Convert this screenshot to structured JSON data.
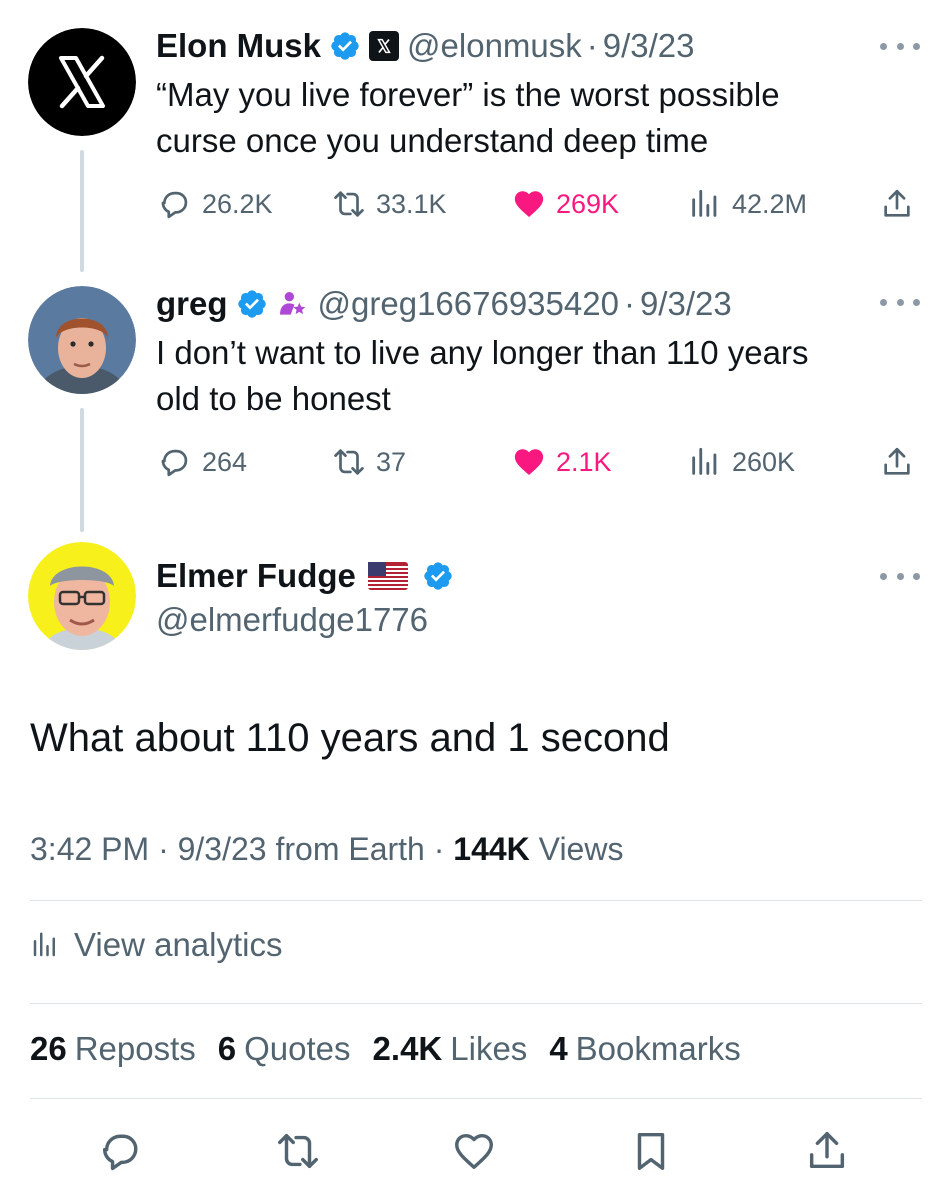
{
  "thread": [
    {
      "name": "Elon Musk",
      "handle": "@elonmusk",
      "separator": "·",
      "date": "9/3/23",
      "text_line1": "“May you live forever” is the worst possible",
      "text_line2": "curse once you understand deep time",
      "replies": "26.2K",
      "reposts": "33.1K",
      "likes": "269K",
      "views": "42.2M"
    },
    {
      "name": "greg",
      "handle": "@greg16676935420",
      "separator": "·",
      "date": "9/3/23",
      "text_line1": "I don’t want to live any longer than 110 years",
      "text_line2": "old to be honest",
      "replies": "264",
      "reposts": "37",
      "likes": "2.1K",
      "views": "260K"
    }
  ],
  "main_tweet": {
    "name": "Elmer Fudge",
    "handle": "@elmerfudge1776",
    "text": "What about 110 years and 1 second",
    "time": "3:42 PM",
    "separator": "·",
    "date_source": "9/3/23 from Earth",
    "views_count": "144K",
    "views_label": "Views",
    "analytics_label": "View analytics",
    "stats": [
      {
        "count": "26",
        "label": "Reposts"
      },
      {
        "count": "6",
        "label": "Quotes"
      },
      {
        "count": "2.4K",
        "label": "Likes"
      },
      {
        "count": "4",
        "label": "Bookmarks"
      }
    ]
  },
  "colors": {
    "like_pink": "#f91880",
    "verified_blue": "#1d9bf0",
    "secondary_text": "#536471"
  },
  "icons": [
    "x-logo-icon",
    "verified-icon",
    "reply-icon",
    "repost-icon",
    "like-icon",
    "views-icon",
    "share-icon",
    "more-icon",
    "bookmark-icon",
    "us-flag-icon",
    "creator-icon"
  ]
}
